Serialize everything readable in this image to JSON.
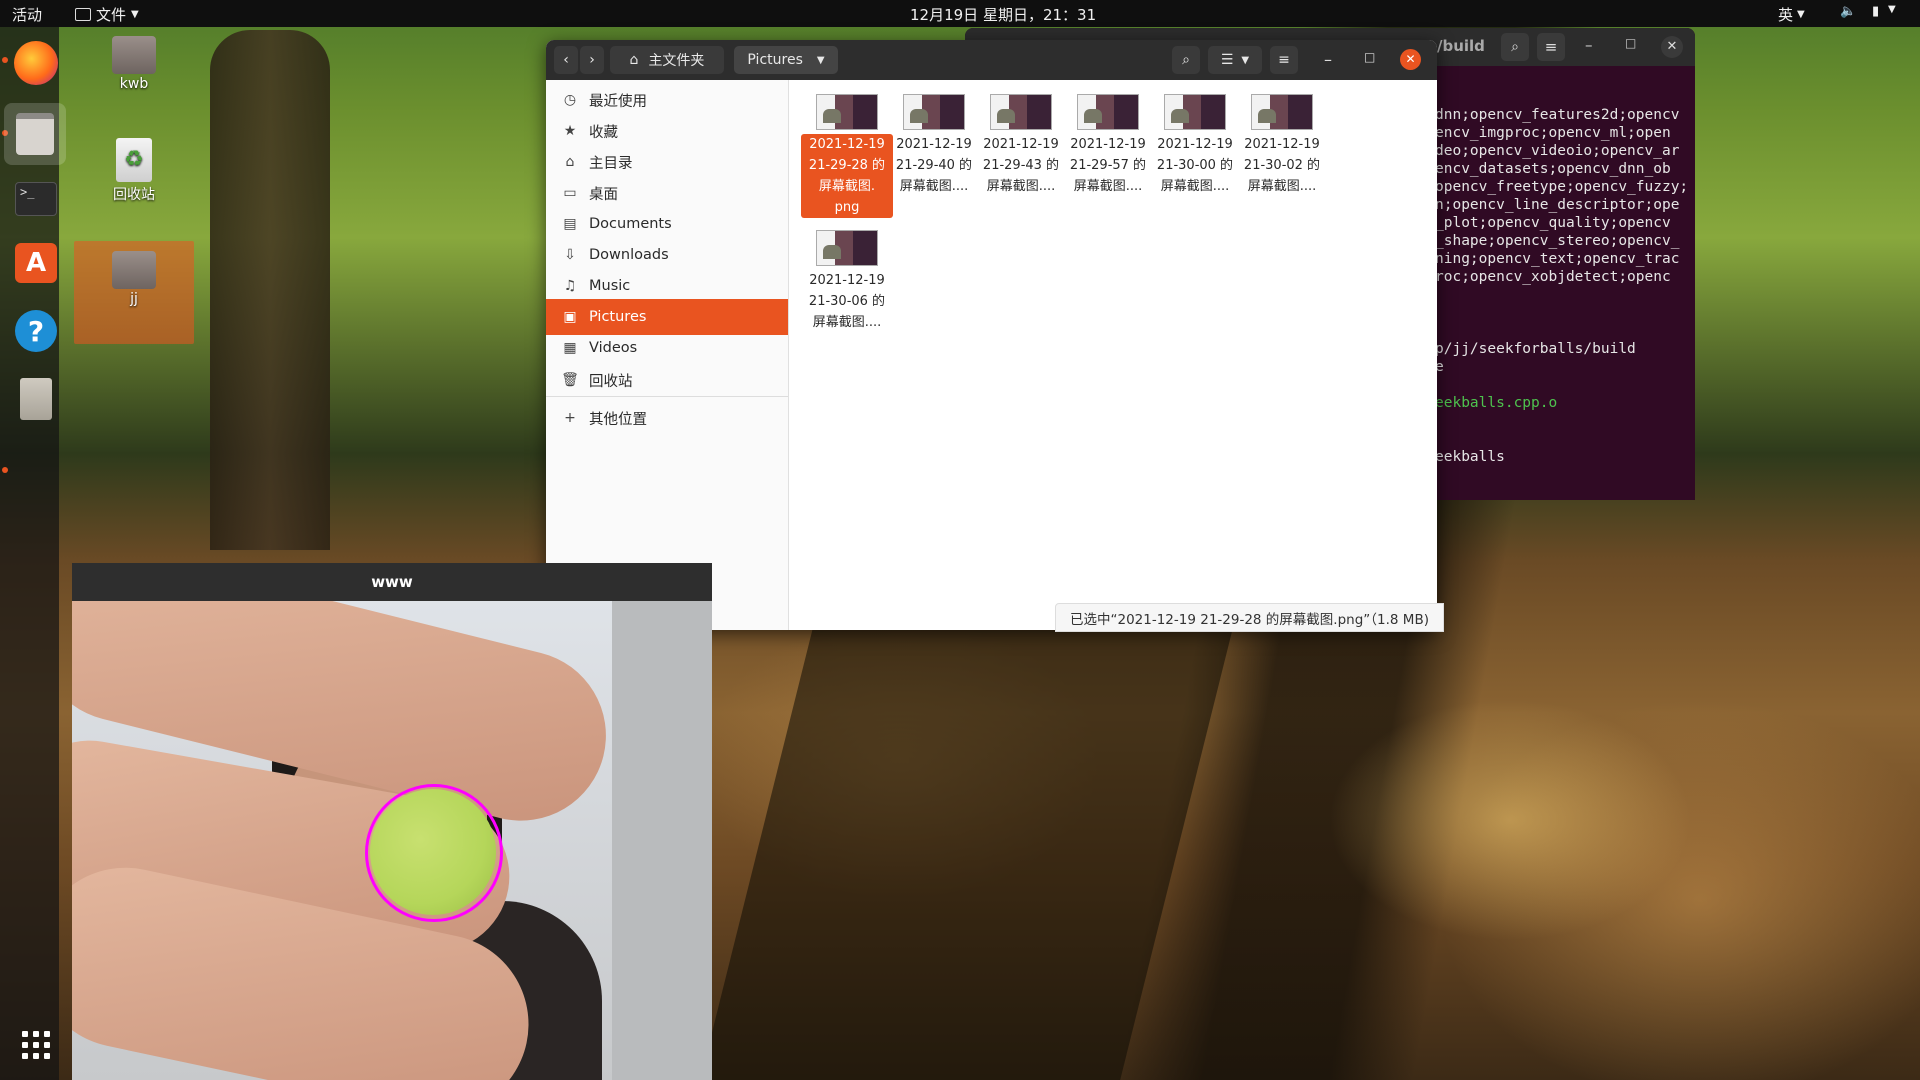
{
  "topbar": {
    "activities": "活动",
    "app_menu": "文件",
    "clock": "12月19日 星期日，21：31",
    "input_method": "英"
  },
  "desktop": {
    "icons": [
      {
        "label": "kwb"
      },
      {
        "label": "回收站"
      },
      {
        "label": "jj"
      }
    ]
  },
  "terminal": {
    "title": "/build",
    "lines": [
      "dnn;opencv_features2d;opencv",
      "encv_imgproc;opencv_ml;open",
      "deo;opencv_videoio;opencv_ar",
      "encv_datasets;opencv_dnn_ob",
      "opencv_freetype;opencv_fuzzy;",
      "n;opencv_line_descriptor;ope",
      "_plot;opencv_quality;opencv",
      "_shape;opencv_stereo;opencv_",
      "ning;opencv_text;opencv_trac",
      "roc;opencv_xobjdetect;openc",
      "",
      "",
      "",
      "p/jj/seekforballs/build",
      "e",
      "",
      "eekballs.cpp.o",
      "",
      "",
      "eekballs"
    ]
  },
  "files": {
    "path": {
      "home": "主文件夹",
      "current": "Pictures"
    },
    "sidebar": [
      {
        "icon": "clock-icon",
        "label": "最近使用"
      },
      {
        "icon": "star-icon",
        "label": "收藏"
      },
      {
        "icon": "home-icon",
        "label": "主目录"
      },
      {
        "icon": "desktop-icon",
        "label": "桌面"
      },
      {
        "icon": "document-icon",
        "label": "Documents"
      },
      {
        "icon": "download-icon",
        "label": "Downloads"
      },
      {
        "icon": "music-icon",
        "label": "Music"
      },
      {
        "icon": "pictures-icon",
        "label": "Pictures"
      },
      {
        "icon": "video-icon",
        "label": "Videos"
      },
      {
        "icon": "trash-icon",
        "label": "回收站"
      },
      {
        "icon": "plus-icon",
        "label": "其他位置"
      }
    ],
    "items": [
      {
        "line1": "2021-12-19",
        "line2": "21-29-28 的",
        "line3": "屏幕截图.",
        "line4": "png"
      },
      {
        "line1": "2021-12-19",
        "line2": "21-29-40 的",
        "line3": "屏幕截图....",
        "line4": ""
      },
      {
        "line1": "2021-12-19",
        "line2": "21-29-43 的",
        "line3": "屏幕截图....",
        "line4": ""
      },
      {
        "line1": "2021-12-19",
        "line2": "21-29-57 的",
        "line3": "屏幕截图....",
        "line4": ""
      },
      {
        "line1": "2021-12-19",
        "line2": "21-30-00 的",
        "line3": "屏幕截图....",
        "line4": ""
      },
      {
        "line1": "2021-12-19",
        "line2": "21-30-02 的",
        "line3": "屏幕截图....",
        "line4": ""
      },
      {
        "line1": "2021-12-19",
        "line2": "21-30-06 的",
        "line3": "屏幕截图....",
        "line4": ""
      }
    ],
    "status": "已选中“2021-12-19 21-29-28 的屏幕截图.png”（1.8 MB)"
  },
  "camera": {
    "title": "www"
  },
  "colors": {
    "accent": "#e95420",
    "terminal_bg": "#300a24",
    "detect_circle": "#ff00ff",
    "ball": "#b5d65a"
  }
}
